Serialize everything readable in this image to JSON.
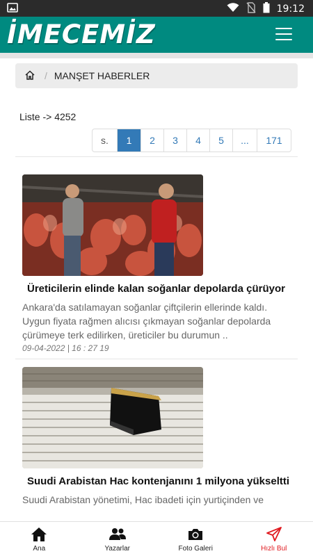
{
  "status_bar": {
    "time": "19:12"
  },
  "app": {
    "logo": "İMECEMİZ"
  },
  "breadcrumb": {
    "current": "MANŞET HABERLER"
  },
  "list": {
    "count_label": "Liste -> 4252"
  },
  "pagination": {
    "items": [
      "s.",
      "1",
      "2",
      "3",
      "4",
      "5",
      "...",
      "171"
    ],
    "active": "1"
  },
  "articles": [
    {
      "title": "Üreticilerin elinde kalan soğanlar depolarda çürüyor",
      "summary": "Ankara'da satılamayan soğanlar çiftçilerin ellerinde kaldı. Uygun fiyata rağmen alıcısı çıkmayan soğanlar depolarda çürümeye terk edilirken, üreticiler bu durumun ..",
      "date": "09-04-2022 | 16 : 27 19"
    },
    {
      "title": "Suudi Arabistan Hac kontenjanını 1 milyona yükseltti",
      "summary": "Suudi Arabistan yönetimi, Hac ibadeti için yurtiçinden ve"
    }
  ],
  "bottom_nav": [
    {
      "label": "Ana",
      "icon": "home-icon"
    },
    {
      "label": "Yazarlar",
      "icon": "users-icon"
    },
    {
      "label": "Foto Galeri",
      "icon": "camera-icon"
    },
    {
      "label": "Hızlı Bul",
      "icon": "send-icon",
      "color": "#e0191f"
    }
  ],
  "colors": {
    "brand": "#008a80",
    "pagination_active": "#337ab7",
    "quick_find": "#e0191f"
  }
}
